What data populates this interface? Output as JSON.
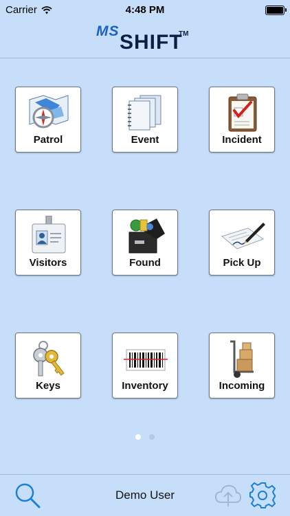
{
  "status_bar": {
    "carrier": "Carrier",
    "time": "4:48 PM"
  },
  "logo": {
    "prefix": "MS",
    "name": "SHIFT",
    "trademark": "TM"
  },
  "grid": {
    "tiles": [
      {
        "label": "Patrol",
        "icon": "map-compass-icon"
      },
      {
        "label": "Event",
        "icon": "notebooks-icon"
      },
      {
        "label": "Incident",
        "icon": "clipboard-check-icon"
      },
      {
        "label": "Visitors",
        "icon": "id-badge-icon"
      },
      {
        "label": "Found",
        "icon": "lost-found-box-icon"
      },
      {
        "label": "Pick Up",
        "icon": "signature-pen-icon"
      },
      {
        "label": "Keys",
        "icon": "keys-icon"
      },
      {
        "label": "Inventory",
        "icon": "barcode-icon"
      },
      {
        "label": "Incoming",
        "icon": "hand-truck-icon"
      }
    ]
  },
  "pagination": {
    "current_page": 1,
    "total_pages": 2
  },
  "bottom_bar": {
    "user_name": "Demo User"
  },
  "colors": {
    "background": "#c6defa",
    "accent": "#1a7fd6",
    "logo_blue": "#1a62c6",
    "logo_dark": "#0a1f45"
  }
}
